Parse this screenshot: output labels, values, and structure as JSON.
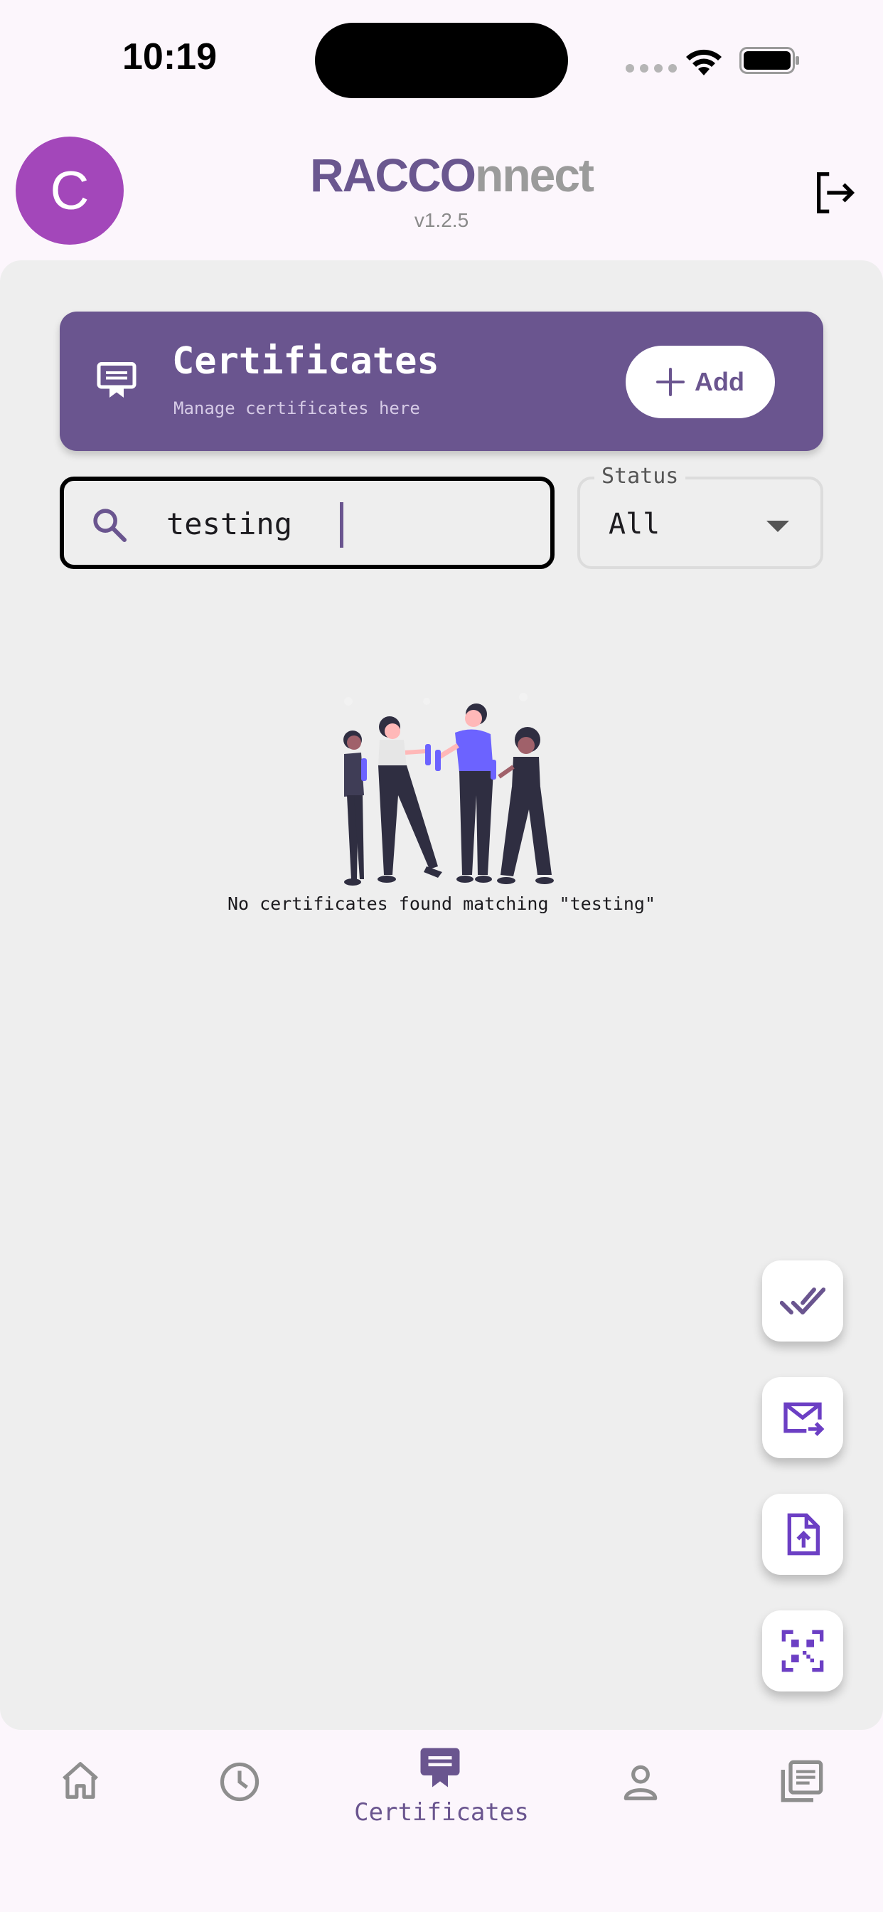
{
  "status_bar": {
    "time": "10:19"
  },
  "header": {
    "avatar_letter": "C",
    "logo_part1": "RACCO",
    "logo_part2": "nnect",
    "version": "v1.2.5"
  },
  "banner": {
    "title": "Certificates",
    "subtitle": "Manage certificates here",
    "add_label": "Add"
  },
  "search": {
    "value": "testing"
  },
  "status_filter": {
    "label": "Status",
    "selected": "All"
  },
  "empty_state": {
    "message": "No certificates found matching \"testing\""
  },
  "fabs": [
    "check-all-icon",
    "forward-email-icon",
    "upload-file-icon",
    "qr-scan-icon"
  ],
  "bottom_nav": {
    "items": [
      {
        "icon": "home-icon"
      },
      {
        "icon": "history-icon"
      },
      {
        "icon": "certificate-icon",
        "label": "Certificates",
        "active": true
      },
      {
        "icon": "profile-icon"
      },
      {
        "icon": "documents-icon"
      }
    ]
  },
  "colors": {
    "primary": "#6a558f",
    "avatar": "#a347ba",
    "accent": "#6c3fc4",
    "inactive": "#8e8e8e"
  }
}
